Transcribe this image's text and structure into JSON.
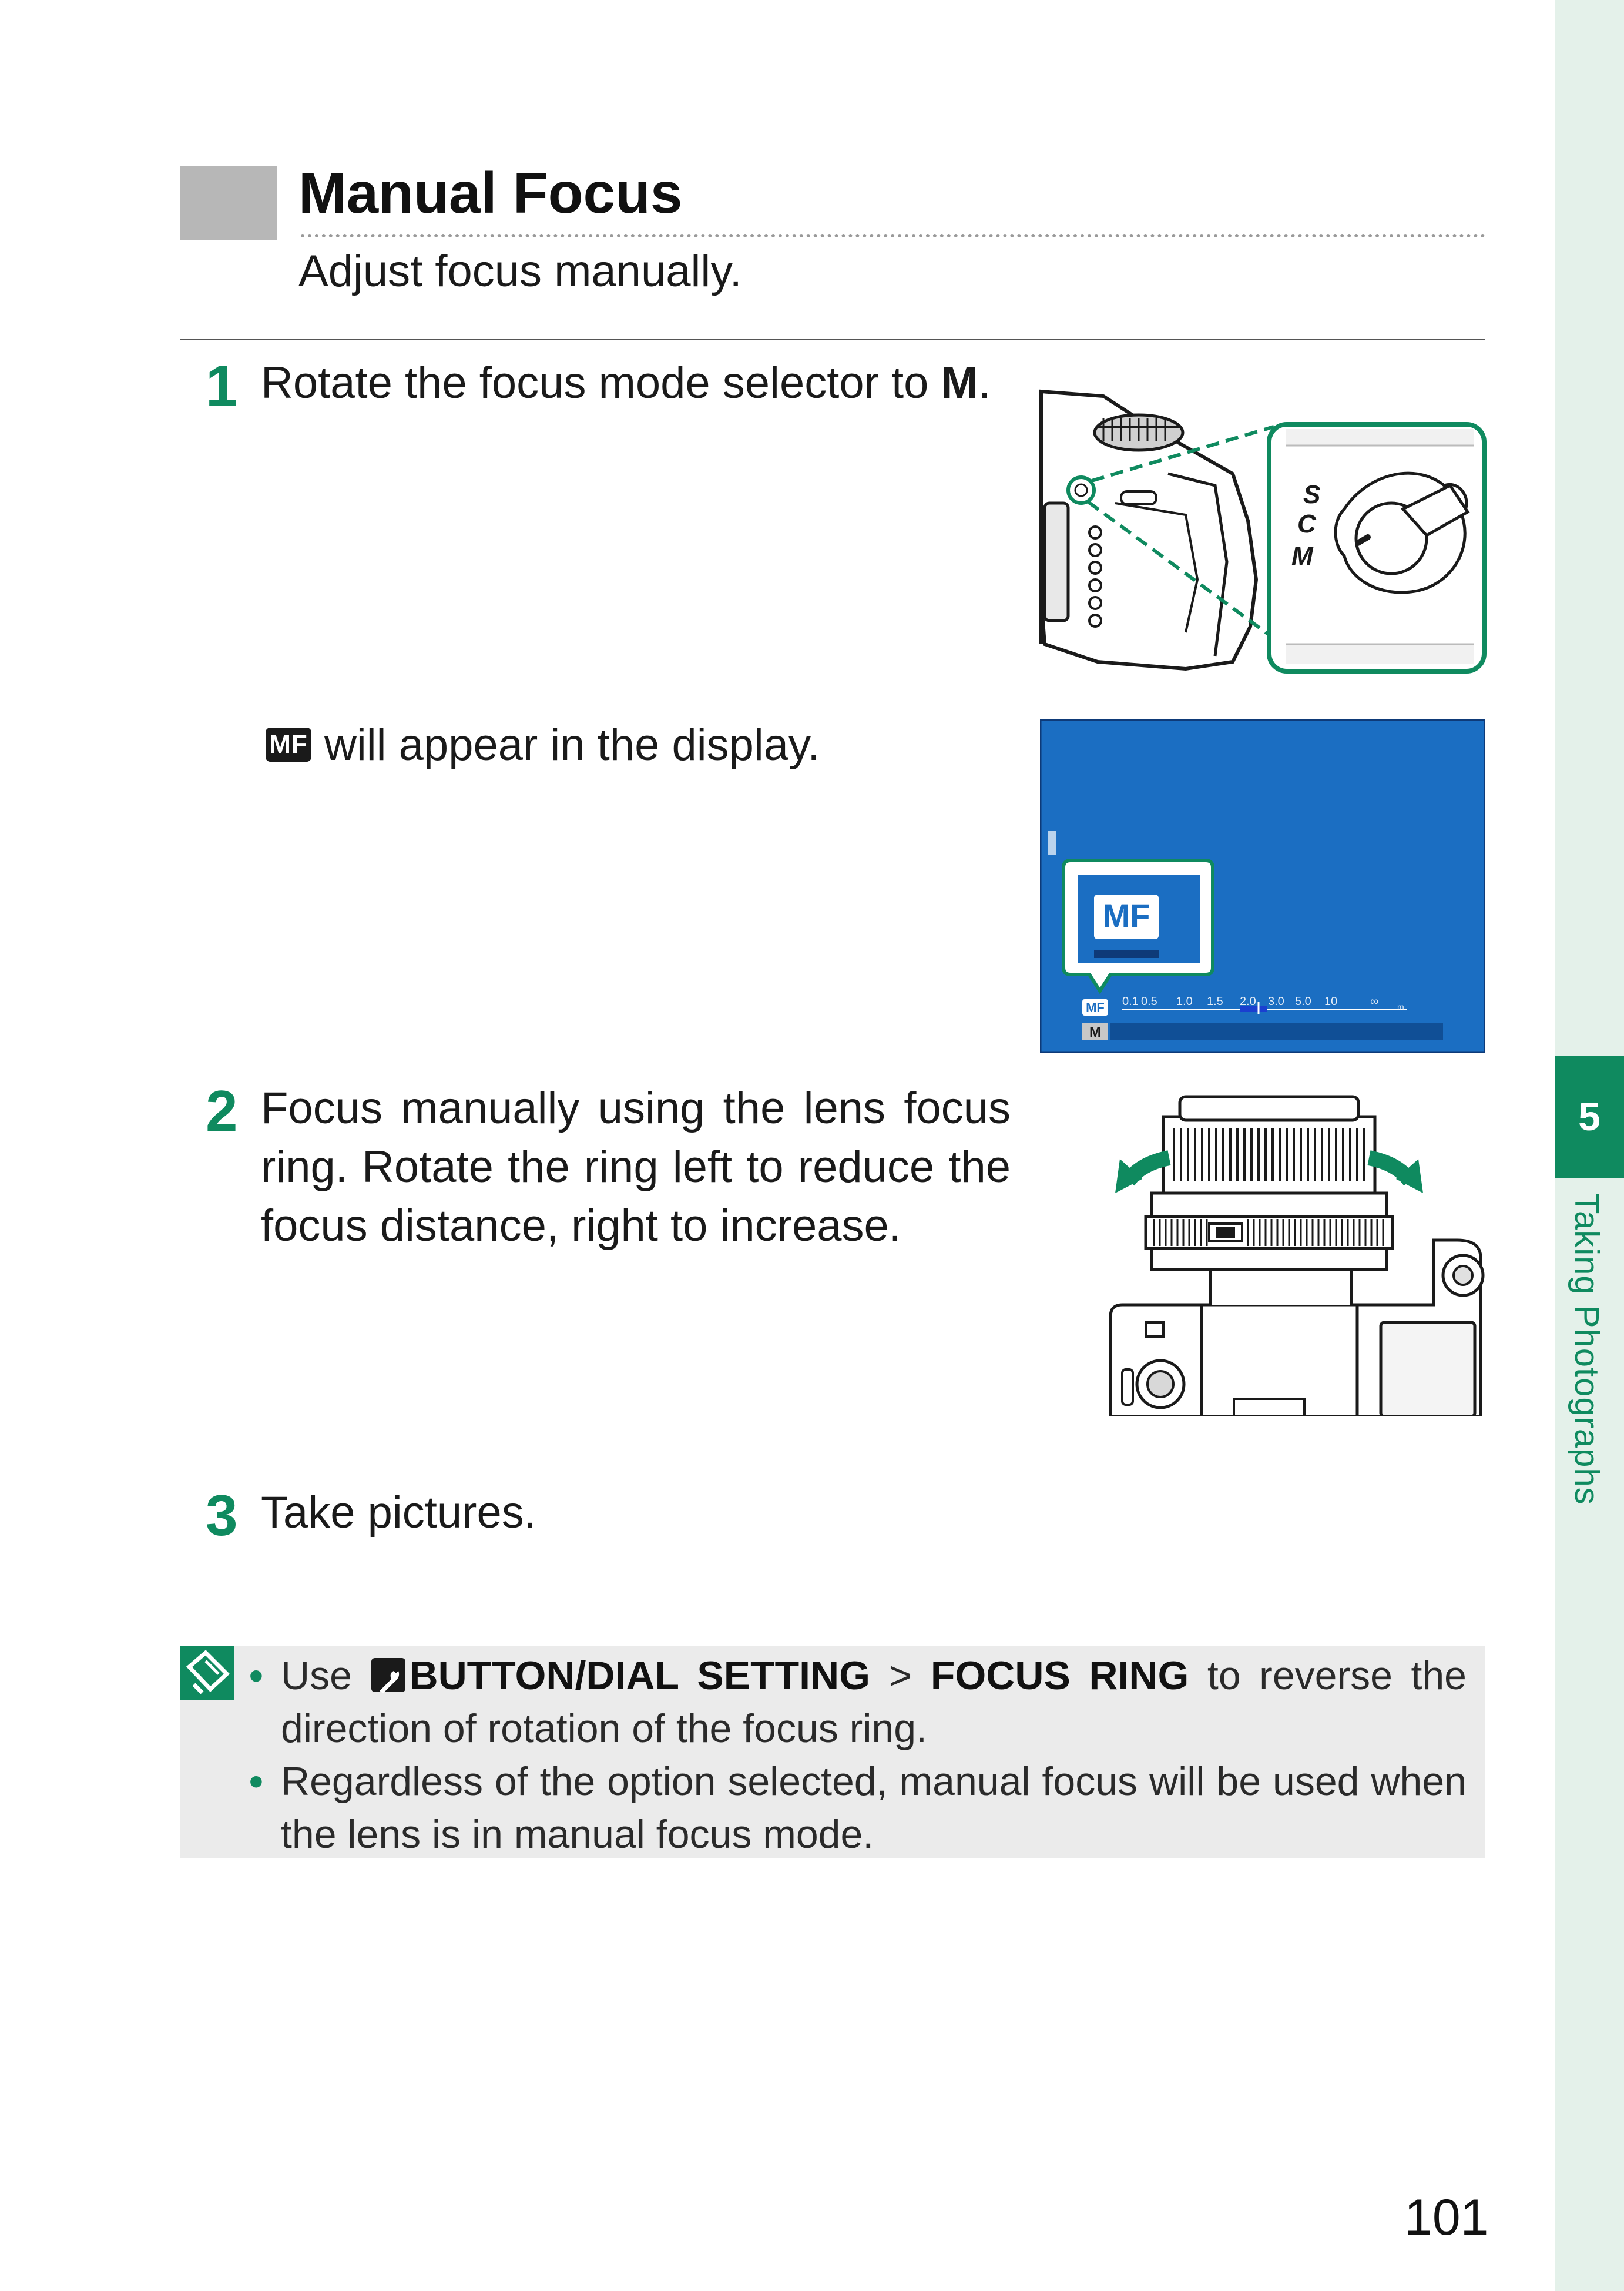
{
  "header": {
    "title": "Manual Focus",
    "subtitle": "Adjust focus manually."
  },
  "steps": [
    {
      "number": "1",
      "text_before": "Rotate the focus mode selector to ",
      "text_bold": "M",
      "text_after": "."
    },
    {
      "number": "2",
      "text": "Focus manually using the lens focus ring. Rotate the ring left to reduce the focus distance, right to increase."
    },
    {
      "number": "3",
      "text": "Take pictures."
    }
  ],
  "display_note": {
    "badge": "MF",
    "text": "will appear in the display."
  },
  "selector_illustration": {
    "dial_labels": [
      "S",
      "C",
      "M"
    ]
  },
  "lcd_illustration": {
    "callout_label": "MF",
    "mode_badge": "MF",
    "manual_badge": "M",
    "scale_ticks": [
      "0.1",
      "0.5",
      "1.0",
      "1.5",
      "2.0",
      "3.0",
      "5.0",
      "10",
      "∞"
    ],
    "scale_unit": "m",
    "background_color": "#1b6ec2",
    "accent_color": "#0f8a5f"
  },
  "note": {
    "icon": "note-icon",
    "bullets": [
      {
        "prefix": "Use ",
        "icon": "wrench-icon",
        "menu_1": "BUTTON/DIAL SETTING",
        "separator": " > ",
        "menu_2": "FOCUS RING",
        "suffix": " to reverse the direction of rotation of the focus ring."
      },
      {
        "text": "Regardless of the option selected, manual focus will be used when the lens is in manual focus mode."
      }
    ]
  },
  "sidebar": {
    "chapter_number": "5",
    "chapter_title": "Taking Photographs"
  },
  "page_number": "101"
}
